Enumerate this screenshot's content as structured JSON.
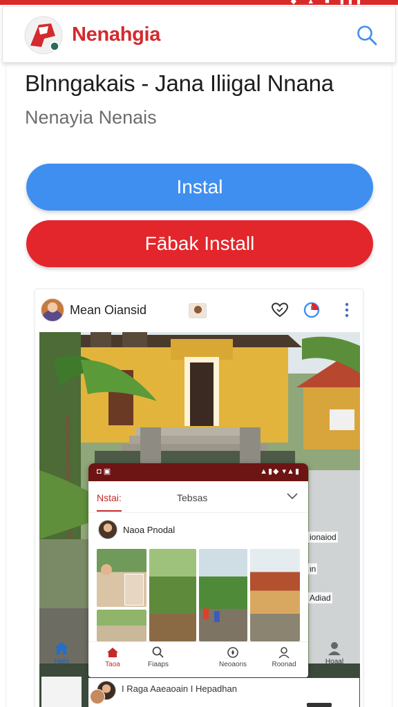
{
  "status_bar": {
    "icons_text": "◆ ▲ ■ ▮▮▮",
    "color": "#d92a2a"
  },
  "header": {
    "brand": "Nenahgia",
    "brand_color": "#d32a2e",
    "logo_icon": "app-logo-icon",
    "search_icon": "search-icon"
  },
  "app": {
    "title": "Blnngakais - Jana Iliigal Nnana",
    "developer": "Nenayia Nenais",
    "install_label": "Instal",
    "fast_install_label": "Fābak Install",
    "install_color": "#3f8ff0",
    "fast_install_color": "#e3262b"
  },
  "preview": {
    "user_name": "Mean Oiansid",
    "icons": [
      "heart-icon",
      "chart-icon",
      "more-vert-icon"
    ],
    "side_labels": [
      "ionaiod",
      "ιn",
      "Adiad"
    ],
    "home_label": "Hahl",
    "profile_label": "Hoaal",
    "inner": {
      "status_left": "◘ ▣",
      "status_right": "▲▮◆ ▾▲▮",
      "tab_active": "Nstai:",
      "tab_second": "Tebsas",
      "user_name": "Naoa Pnodal",
      "nav": [
        "Taoa",
        "Fiaaps",
        "Neoaons",
        "Roonad"
      ]
    },
    "footer_text": "Ι Raga Aaeaoain Ι Hepadhan"
  }
}
